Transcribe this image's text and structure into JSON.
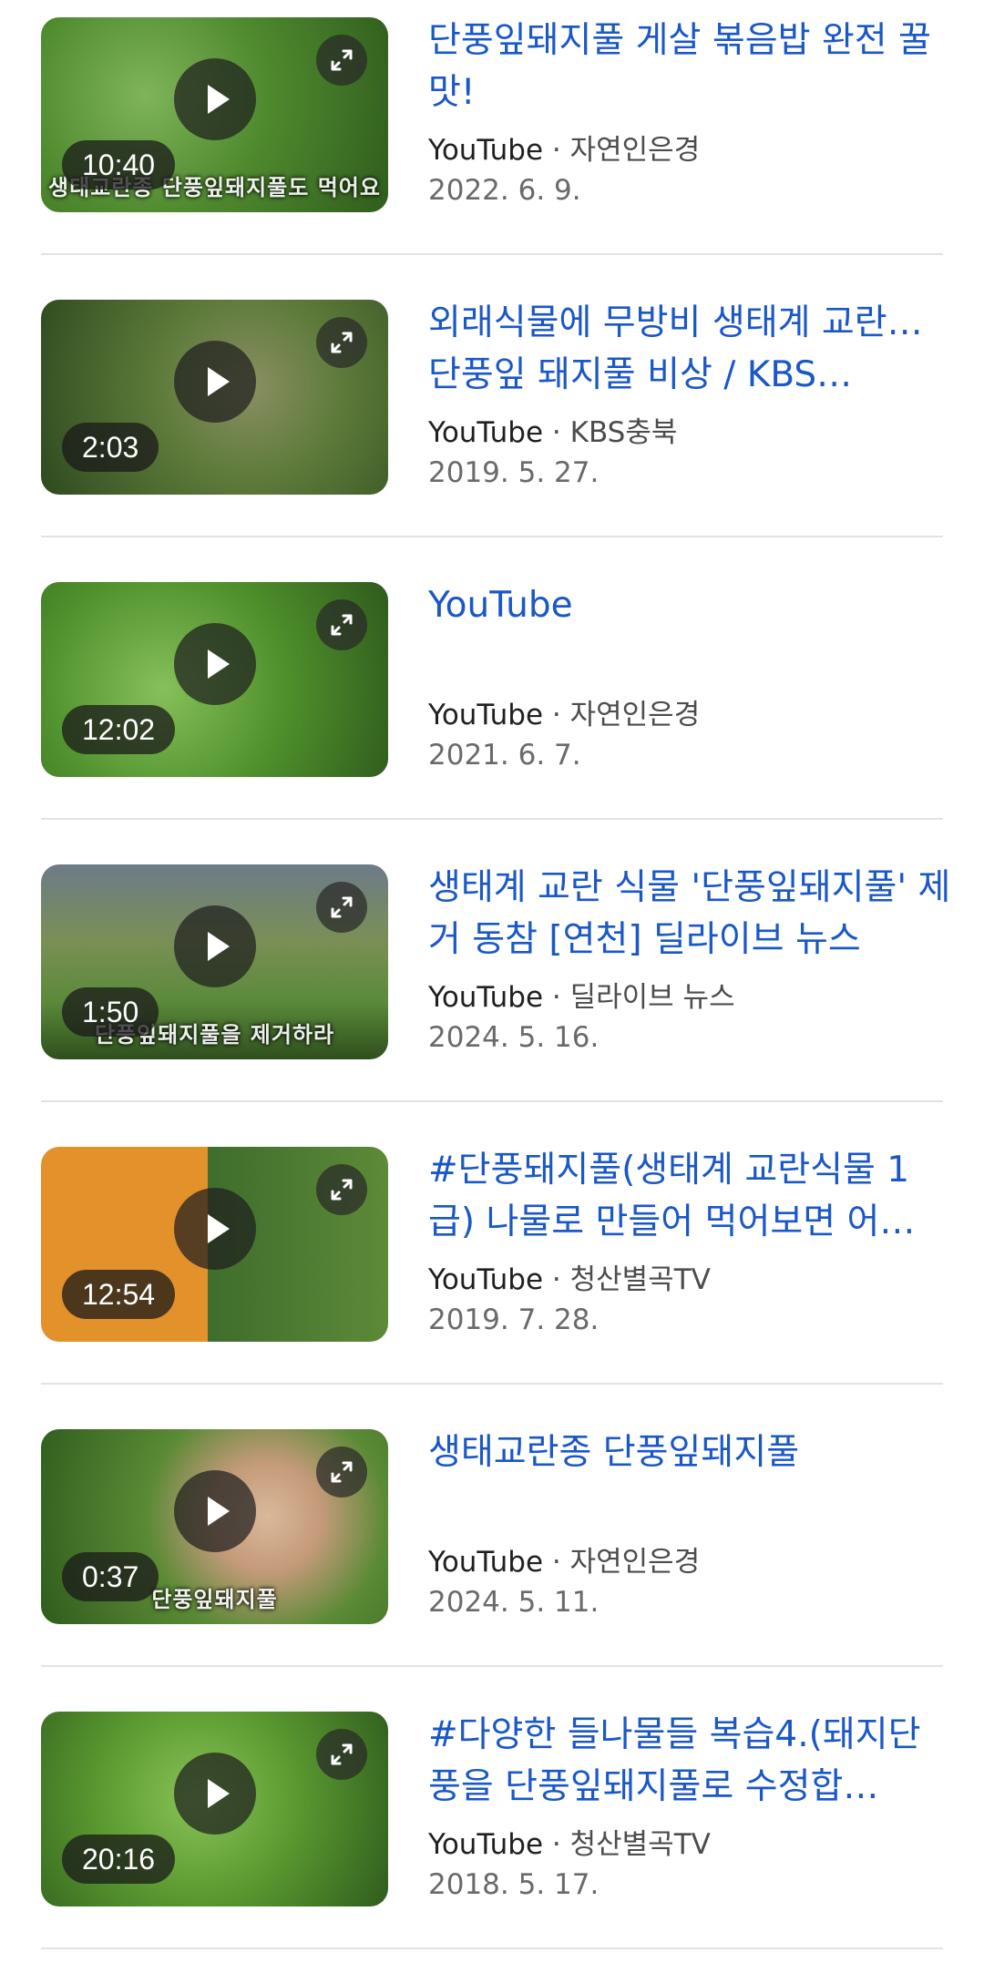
{
  "results": [
    {
      "title": "단풍잎돼지풀 게살 볶음밥 완전 꿀맛!",
      "site": "YouTube",
      "channel": "자연인은경",
      "date": "2022. 6. 9.",
      "duration": "10:40",
      "thumb_caption": "생태교란종 단풍잎돼지풀도 먹어요"
    },
    {
      "title": "외래식물에 무방비 생태계 교란…단풍잎 돼지풀 비상 / KBS…",
      "site": "YouTube",
      "channel": "KBS충북",
      "date": "2019. 5. 27.",
      "duration": "2:03",
      "thumb_caption": ""
    },
    {
      "title": "YouTube",
      "site": "YouTube",
      "channel": "자연인은경",
      "date": "2021. 6. 7.",
      "duration": "12:02",
      "thumb_caption": ""
    },
    {
      "title": "생태계 교란 식물 '단풍잎돼지풀' 제거 동참 [연천] 딜라이브 뉴스",
      "site": "YouTube",
      "channel": "딜라이브 뉴스",
      "date": "2024. 5. 16.",
      "duration": "1:50",
      "thumb_caption": "단풍잎돼지풀을 제거하라"
    },
    {
      "title": "#단풍돼지풀(생태계 교란식물 1급) 나물로 만들어 먹어보면 어…",
      "site": "YouTube",
      "channel": "청산별곡TV",
      "date": "2019. 7. 28.",
      "duration": "12:54",
      "thumb_caption": ""
    },
    {
      "title": "생태교란종 단풍잎돼지풀",
      "site": "YouTube",
      "channel": "자연인은경",
      "date": "2024. 5. 11.",
      "duration": "0:37",
      "thumb_caption": "단풍잎돼지풀"
    },
    {
      "title": "#다양한 들나물들 복습4.(돼지단풍을 단풍잎돼지풀로 수정합…",
      "site": "YouTube",
      "channel": "청산별곡TV",
      "date": "2018. 5. 17.",
      "duration": "20:16",
      "thumb_caption": ""
    }
  ],
  "source_separator": " · ",
  "colors": {
    "title_link": "#1a57c7",
    "thumb_green": "#4f8a2e",
    "thumb_dark_green": "#2f5c1d"
  },
  "icons": {
    "play": "play-icon",
    "expand": "expand-icon"
  }
}
